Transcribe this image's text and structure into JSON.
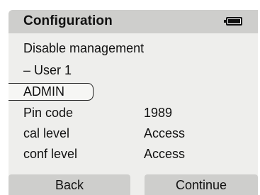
{
  "header": {
    "title": "Configuration",
    "battery_icon": "battery-full-icon"
  },
  "menu": {
    "line1": "Disable management",
    "line2": "– User 1",
    "selected": "ADMIN",
    "fields": [
      {
        "label": "Pin code",
        "value": "1989"
      },
      {
        "label": "cal level",
        "value": "Access"
      },
      {
        "label": "conf level",
        "value": "Access"
      }
    ]
  },
  "softkeys": {
    "left": "Back",
    "right": "Continue"
  }
}
